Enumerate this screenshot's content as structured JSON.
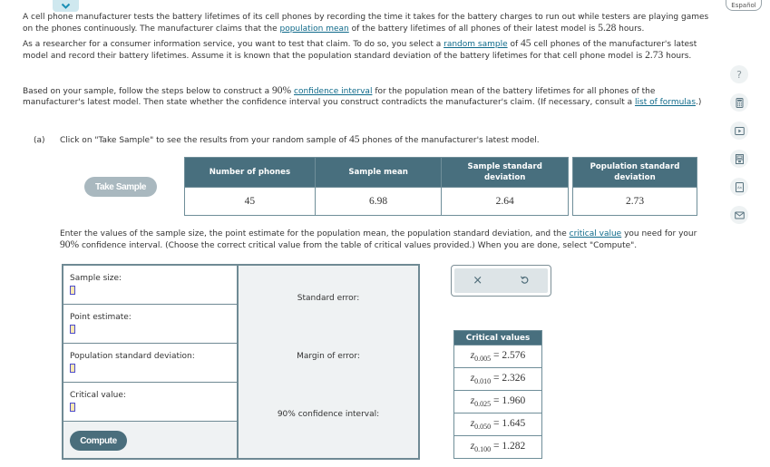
{
  "header": {
    "collapse_icon": "chevron-down-icon",
    "language_button": "Español"
  },
  "intro": {
    "p1_a": "A cell phone manufacturer tests the battery lifetimes of its cell phones by recording the time it takes for the battery charges to run out while testers are playing games on the phones continuously. The manufacturer claims that the ",
    "p1_link": "population mean",
    "p1_b": " of the battery lifetimes of all phones of their latest model is ",
    "p1_value": "5.28",
    "p1_c": " hours.",
    "p2_a": "As a researcher for a consumer information service, you want to test that claim. To do so, you select a ",
    "p2_link": "random sample",
    "p2_b": " of ",
    "p2_value": "45",
    "p2_c": " cell phones of the manufacturer's latest model and record their battery lifetimes. Assume it is known that the population standard deviation of the battery lifetimes for that cell phone model is ",
    "p2_sd": "2.73",
    "p2_d": " hours."
  },
  "instructions": {
    "a": "Based on your sample, follow the steps below to construct a ",
    "conf": "90%",
    "b": " ",
    "link1": "confidence interval",
    "c": " for the population mean of the battery lifetimes for all phones of the manufacturer's latest model. Then state whether the confidence interval you construct contradicts the manufacturer's claim. (If necessary, consult a ",
    "link2": "list of formulas",
    "d": ".)"
  },
  "part_a": {
    "label": "(a)",
    "text_a": "Click on \"Take Sample\" to see the results from your random sample of ",
    "n": "45",
    "text_b": " phones of the manufacturer's latest model."
  },
  "take_sample_button": "Take Sample",
  "sample_table": {
    "headers": [
      "Number of phones",
      "Sample mean",
      "Sample standard deviation",
      "Population standard deviation"
    ],
    "values": [
      "45",
      "6.98",
      "2.64",
      "2.73"
    ]
  },
  "enter_instructions": {
    "a": "Enter the values of the sample size, the point estimate for the population mean, the population standard deviation, and the ",
    "link": "critical value",
    "b": " you need for your ",
    "conf": "90%",
    "c": " confidence interval. (Choose the correct critical value from the table of critical values provided.) When you are done, select \"Compute\"."
  },
  "form": {
    "fields": [
      {
        "label": "Sample size:",
        "value": ""
      },
      {
        "label": "Point estimate:",
        "value": ""
      },
      {
        "label": "Population standard deviation:",
        "value": ""
      },
      {
        "label": "Critical value:",
        "value": ""
      }
    ],
    "compute_button": "Compute",
    "results": {
      "standard_error": "Standard error:",
      "margin_of_error": "Margin of error:",
      "confidence_interval": "90% confidence interval:"
    }
  },
  "actions": {
    "clear": "×",
    "undo_icon": "undo-icon"
  },
  "critical_values": {
    "title": "Critical values",
    "rows": [
      {
        "sub": "0.005",
        "value": "2.576"
      },
      {
        "sub": "0.010",
        "value": "2.326"
      },
      {
        "sub": "0.025",
        "value": "1.960"
      },
      {
        "sub": "0.050",
        "value": "1.645"
      },
      {
        "sub": "0.100",
        "value": "1.282"
      }
    ]
  },
  "sidebar": {
    "icons": [
      "help-icon",
      "calculator-icon",
      "video-icon",
      "data-table-icon",
      "dictionary-icon",
      "mail-icon"
    ],
    "help_glyph": "?"
  }
}
